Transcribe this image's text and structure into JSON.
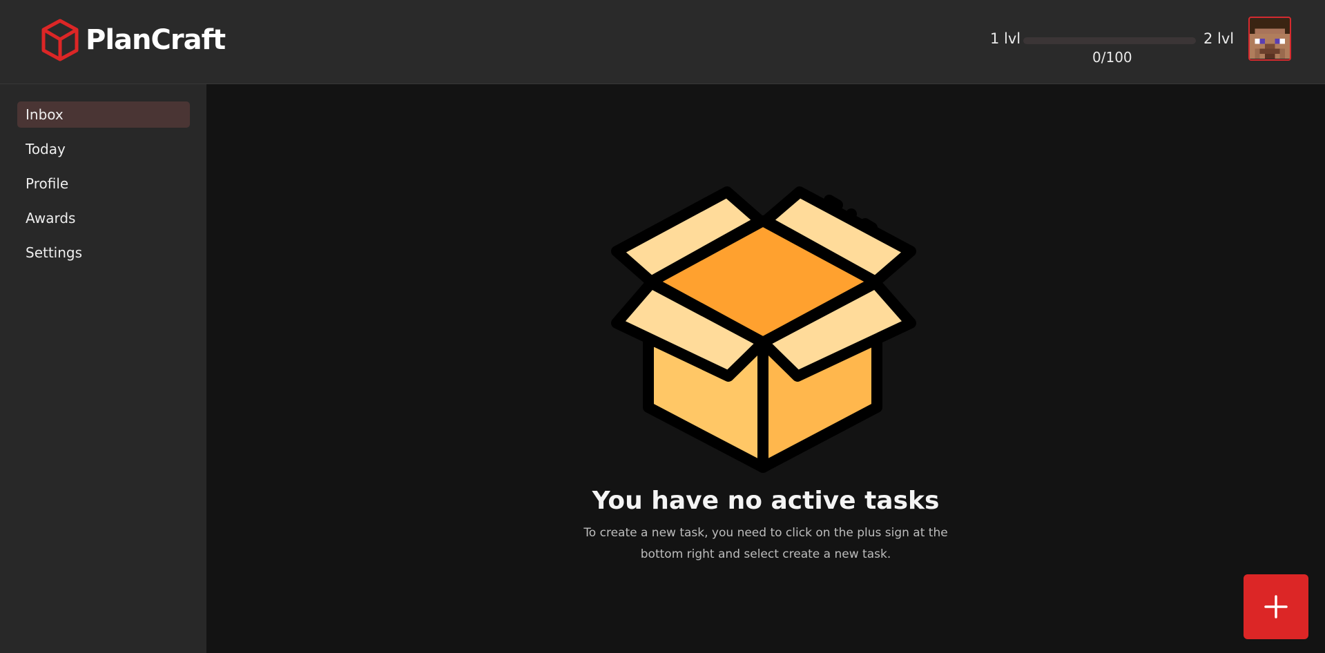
{
  "app": {
    "name": "PlanCraft",
    "brand_color": "#dc2626"
  },
  "header": {
    "level_current": "1 lvl",
    "level_next": "2 lvl",
    "xp_text": "0/100",
    "xp_progress": 0,
    "avatar_icon": "minecraft-steve-avatar"
  },
  "sidebar": {
    "items": [
      {
        "label": "Inbox",
        "active": true
      },
      {
        "label": "Today",
        "active": false
      },
      {
        "label": "Profile",
        "active": false
      },
      {
        "label": "Awards",
        "active": false
      },
      {
        "label": "Settings",
        "active": false
      }
    ]
  },
  "main": {
    "empty_icon": "open-box-icon",
    "empty_title": "You have no active tasks",
    "empty_description": "To create a new task, you need to click on the plus sign at the bottom right and select create a new task.",
    "fab_icon": "plus-icon"
  }
}
